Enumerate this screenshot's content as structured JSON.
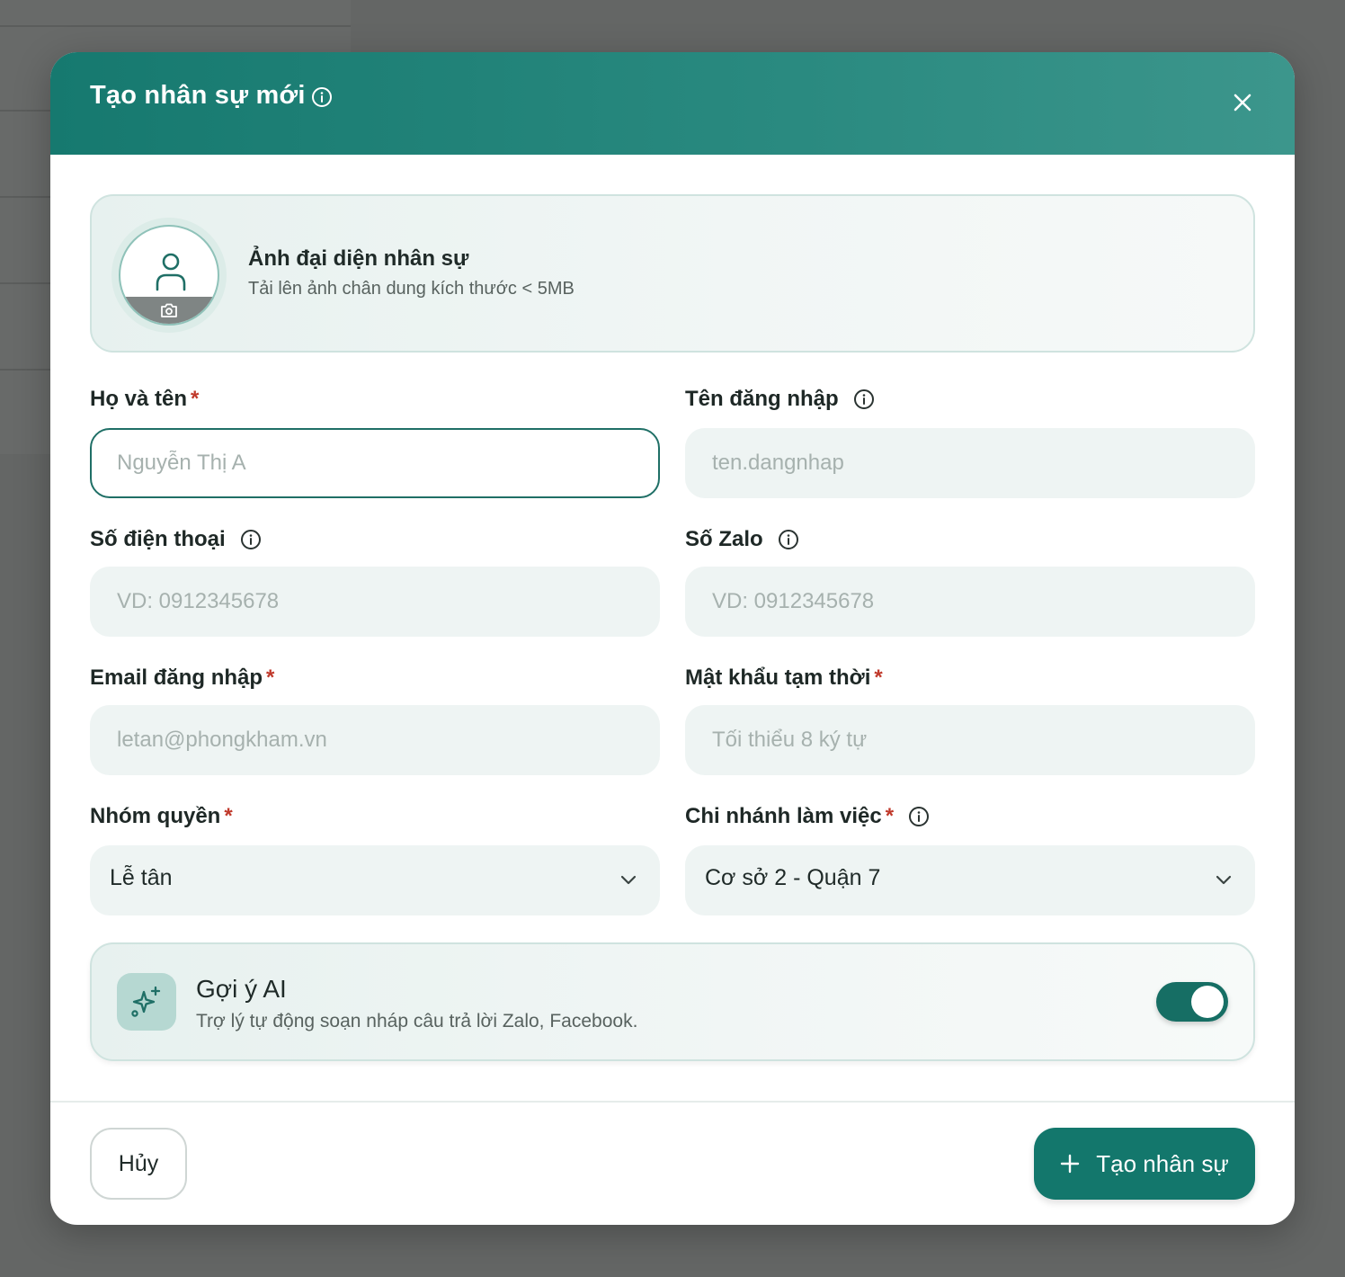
{
  "modal": {
    "title": "Tạo nhân sự mới"
  },
  "avatar": {
    "title": "Ảnh đại diện nhân sự",
    "subtitle": "Tải lên ảnh chân dung kích thước < 5MB"
  },
  "fields": {
    "full_name": {
      "label": "Họ và tên",
      "required": "*",
      "placeholder": "Nguyễn Thị A",
      "value": ""
    },
    "username": {
      "label": "Tên đăng nhập",
      "placeholder": "ten.dangnhap",
      "value": ""
    },
    "phone": {
      "label": "Số điện thoại",
      "placeholder": "VD: 0912345678",
      "value": ""
    },
    "zalo": {
      "label": "Số Zalo",
      "placeholder": "VD: 0912345678",
      "value": ""
    },
    "email": {
      "label": "Email đăng nhập",
      "required": "*",
      "placeholder": "letan@phongkham.vn",
      "value": ""
    },
    "password": {
      "label": "Mật khẩu tạm thời",
      "required": "*",
      "placeholder": "Tối thiểu 8 ký tự",
      "value": ""
    },
    "role": {
      "label": "Nhóm quyền",
      "required": "*",
      "selected": "Lễ tân"
    },
    "branch": {
      "label": "Chi nhánh làm việc",
      "required": "*",
      "selected": "Cơ sở 2 - Quận 7"
    }
  },
  "ai": {
    "title": "Gợi ý AI",
    "subtitle": "Trợ lý tự động soạn nháp câu trả lời Zalo, Facebook.",
    "enabled": true
  },
  "footer": {
    "cancel_label": "Hủy",
    "create_label": "Tạo nhân sự"
  },
  "icons": {
    "header_info": "info-icon",
    "close": "close-icon",
    "avatar": "user-icon",
    "camera": "camera-icon",
    "chevron": "chevron-down-icon",
    "ai": "sparkles-icon",
    "plus": "plus-icon"
  },
  "colors": {
    "primary": "#13776c",
    "header_start": "#16796f",
    "header_end": "#3c968c",
    "required": "#c0392b",
    "input_bg": "#eef4f3"
  }
}
